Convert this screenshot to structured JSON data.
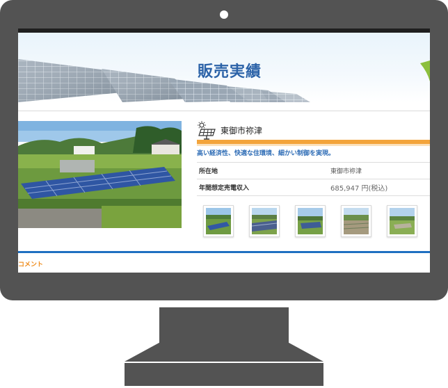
{
  "page": {
    "hero_title": "販売実績",
    "site_name": "東御市祢津",
    "tagline": "高い経済性、快適な住環境、細かい制御を実現。",
    "info": [
      {
        "key": "所在地",
        "value": "東御市祢津"
      },
      {
        "key": "年間想定売電収入",
        "value": "685,947 円(税込)"
      }
    ],
    "thumbnails": [
      "photo-1",
      "photo-2",
      "photo-3",
      "photo-4",
      "photo-5"
    ],
    "comment_heading": "コメント"
  },
  "icons": {
    "site": "solar-panel-icon"
  },
  "colors": {
    "bezel": "#535353",
    "hero_title": "#2c63a8",
    "tagline": "#2f6db6",
    "accent_orange": "#f3a43b",
    "accent_blue": "#1f6fc1",
    "comment_heading": "#ef8b1a"
  }
}
